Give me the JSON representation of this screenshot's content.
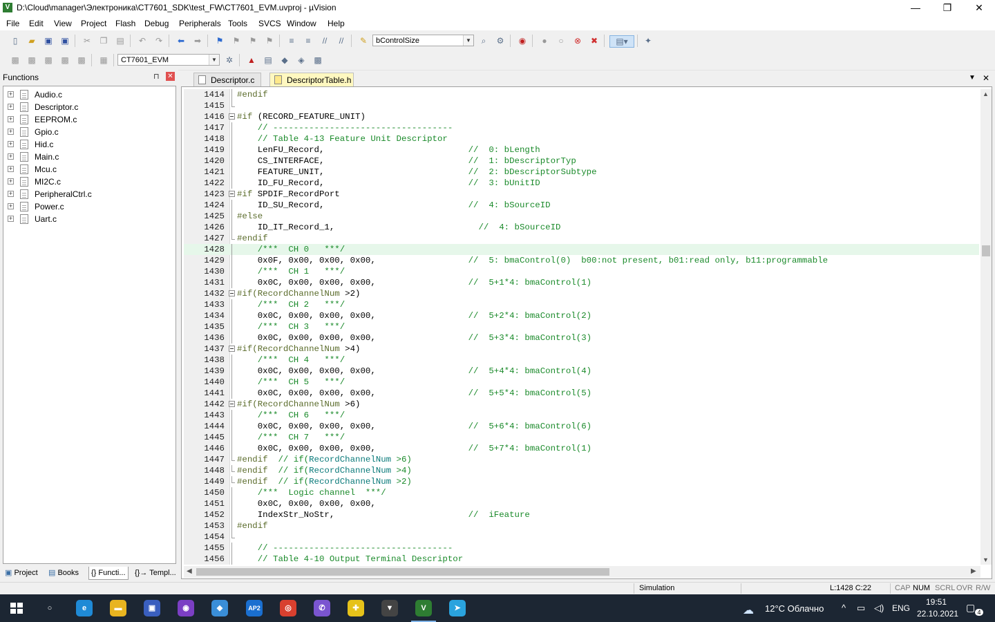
{
  "window": {
    "title": "D:\\Cloud\\manager\\Электроника\\CT7601_SDK\\test_FW\\CT7601_EVM.uvproj - µVision",
    "app_icon": "V",
    "minimize": "—",
    "maximize": "❐",
    "close": "✕"
  },
  "menu": [
    "File",
    "Edit",
    "View",
    "Project",
    "Flash",
    "Debug",
    "Peripherals",
    "Tools",
    "SVCS",
    "Window",
    "Help"
  ],
  "toolbar1": {
    "find_combo": "bControlSize"
  },
  "toolbar2": {
    "target_combo": "CT7601_EVM"
  },
  "functions_panel": {
    "title": "Functions",
    "pin": "⊓",
    "close": "✕",
    "files": [
      "Audio.c",
      "Descriptor.c",
      "EEPROM.c",
      "Gpio.c",
      "Hid.c",
      "Main.c",
      "Mcu.c",
      "MI2C.c",
      "PeripheralCtrl.c",
      "Power.c",
      "Uart.c"
    ],
    "expand_glyph": "+"
  },
  "bottom_tabs": [
    "Project",
    "Books",
    "{} Functi...",
    "{}→ Templ..."
  ],
  "editor": {
    "tabs": [
      "Descriptor.c",
      "DescriptorTable.h"
    ],
    "active_tab": 1,
    "tab_menu": "▼",
    "tab_close": "✕",
    "lines": [
      {
        "n": "1414",
        "fold": "line",
        "src": "#endif"
      },
      {
        "n": "1415",
        "fold": "end",
        "src": ""
      },
      {
        "n": "1416",
        "fold": "box",
        "src": "#if (RECORD_FEATURE_UNIT)"
      },
      {
        "n": "1417",
        "fold": "line",
        "src": "    // -----------------------------------"
      },
      {
        "n": "1418",
        "fold": "line",
        "src": "    // Table 4-13 Feature Unit Descriptor"
      },
      {
        "n": "1419",
        "fold": "line",
        "src": "    LenFU_Record,                            //  0: bLength"
      },
      {
        "n": "1420",
        "fold": "line",
        "src": "    CS_INTERFACE,                            //  1: bDescriptorTyp"
      },
      {
        "n": "1421",
        "fold": "line",
        "src": "    FEATURE_UNIT,                            //  2: bDescriptorSubtype"
      },
      {
        "n": "1422",
        "fold": "line",
        "src": "    ID_FU_Record,                            //  3: bUnitID"
      },
      {
        "n": "1423",
        "fold": "box",
        "src": "#if SPDIF_RecordPort"
      },
      {
        "n": "1424",
        "fold": "line",
        "src": "    ID_SU_Record,                            //  4: bSourceID"
      },
      {
        "n": "1425",
        "fold": "line",
        "src": "#else"
      },
      {
        "n": "1426",
        "fold": "line",
        "src": "    ID_IT_Record_1,                            //  4: bSourceID"
      },
      {
        "n": "1427",
        "fold": "end",
        "src": "#endif"
      },
      {
        "n": "1428",
        "fold": "line",
        "src": "    /***  CH 0   ***/",
        "hl": true
      },
      {
        "n": "1429",
        "fold": "line",
        "src": "    0x0F, 0x00, 0x00, 0x00,                  //  5: bmaControl(0)  b00:not present, b01:read only, b11:programmable"
      },
      {
        "n": "1430",
        "fold": "line",
        "src": "    /***  CH 1   ***/"
      },
      {
        "n": "1431",
        "fold": "line",
        "src": "    0x0C, 0x00, 0x00, 0x00,                  //  5+1*4: bmaControl(1)"
      },
      {
        "n": "1432",
        "fold": "box",
        "src": "#if(RecordChannelNum >2)"
      },
      {
        "n": "1433",
        "fold": "line",
        "src": "    /***  CH 2   ***/"
      },
      {
        "n": "1434",
        "fold": "line",
        "src": "    0x0C, 0x00, 0x00, 0x00,                  //  5+2*4: bmaControl(2)"
      },
      {
        "n": "1435",
        "fold": "line",
        "src": "    /***  CH 3   ***/"
      },
      {
        "n": "1436",
        "fold": "line",
        "src": "    0x0C, 0x00, 0x00, 0x00,                  //  5+3*4: bmaControl(3)"
      },
      {
        "n": "1437",
        "fold": "box",
        "src": "#if(RecordChannelNum >4)"
      },
      {
        "n": "1438",
        "fold": "line",
        "src": "    /***  CH 4   ***/"
      },
      {
        "n": "1439",
        "fold": "line",
        "src": "    0x0C, 0x00, 0x00, 0x00,                  //  5+4*4: bmaControl(4)"
      },
      {
        "n": "1440",
        "fold": "line",
        "src": "    /***  CH 5   ***/"
      },
      {
        "n": "1441",
        "fold": "line",
        "src": "    0x0C, 0x00, 0x00, 0x00,                  //  5+5*4: bmaControl(5)"
      },
      {
        "n": "1442",
        "fold": "box",
        "src": "#if(RecordChannelNum >6)"
      },
      {
        "n": "1443",
        "fold": "line",
        "src": "    /***  CH 6   ***/"
      },
      {
        "n": "1444",
        "fold": "line",
        "src": "    0x0C, 0x00, 0x00, 0x00,                  //  5+6*4: bmaControl(6)"
      },
      {
        "n": "1445",
        "fold": "line",
        "src": "    /***  CH 7   ***/"
      },
      {
        "n": "1446",
        "fold": "line",
        "src": "    0x0C, 0x00, 0x00, 0x00,                  //  5+7*4: bmaControl(1)"
      },
      {
        "n": "1447",
        "fold": "end",
        "src": "#endif  // if(RecordChannelNum >6)"
      },
      {
        "n": "1448",
        "fold": "end",
        "src": "#endif  // if(RecordChannelNum >4)"
      },
      {
        "n": "1449",
        "fold": "end",
        "src": "#endif  // if(RecordChannelNum >2)"
      },
      {
        "n": "1450",
        "fold": "line",
        "src": "    /***  Logic channel  ***/"
      },
      {
        "n": "1451",
        "fold": "line",
        "src": "    0x0C, 0x00, 0x00, 0x00,"
      },
      {
        "n": "1452",
        "fold": "line",
        "src": "    IndexStr_NoStr,                          //  iFeature"
      },
      {
        "n": "1453",
        "fold": "line",
        "src": "#endif"
      },
      {
        "n": "1454",
        "fold": "end",
        "src": ""
      },
      {
        "n": "1455",
        "fold": "line",
        "src": "    // -----------------------------------"
      },
      {
        "n": "1456",
        "fold": "line",
        "src": "    // Table 4-10 Output Terminal Descriptor"
      }
    ]
  },
  "status": {
    "mode": "Simulation",
    "position": "L:1428 C:22",
    "flags": [
      "CAP",
      "NUM",
      "SCRL",
      "OVR",
      "R/W"
    ]
  },
  "taskbar": {
    "weather": "12°C  Облачно",
    "lang": "ENG",
    "time": "19:51",
    "date": "22.10.2021",
    "notifications": "4",
    "apps": [
      {
        "name": "search",
        "glyph": "○",
        "color": "#1c2633"
      },
      {
        "name": "edge",
        "glyph": "e",
        "color": "#1f8ad6"
      },
      {
        "name": "explorer",
        "glyph": "▬",
        "color": "#e8b420"
      },
      {
        "name": "floppy",
        "glyph": "▣",
        "color": "#3a5fbf"
      },
      {
        "name": "podcast",
        "glyph": "◉",
        "color": "#7b3fc4"
      },
      {
        "name": "messenger",
        "glyph": "◆",
        "color": "#3a8ed8"
      },
      {
        "name": "ap2",
        "glyph": "AP2",
        "color": "#1a6fd0"
      },
      {
        "name": "chrome",
        "glyph": "◎",
        "color": "#d8402f"
      },
      {
        "name": "viber",
        "glyph": "✆",
        "color": "#7a55d0"
      },
      {
        "name": "puzzle",
        "glyph": "✚",
        "color": "#e6c21a"
      },
      {
        "name": "fox",
        "glyph": "▼",
        "color": "#444"
      },
      {
        "name": "uvision",
        "glyph": "V",
        "color": "#2e7d32"
      },
      {
        "name": "telegram",
        "glyph": "➤",
        "color": "#2aa3de"
      }
    ]
  }
}
